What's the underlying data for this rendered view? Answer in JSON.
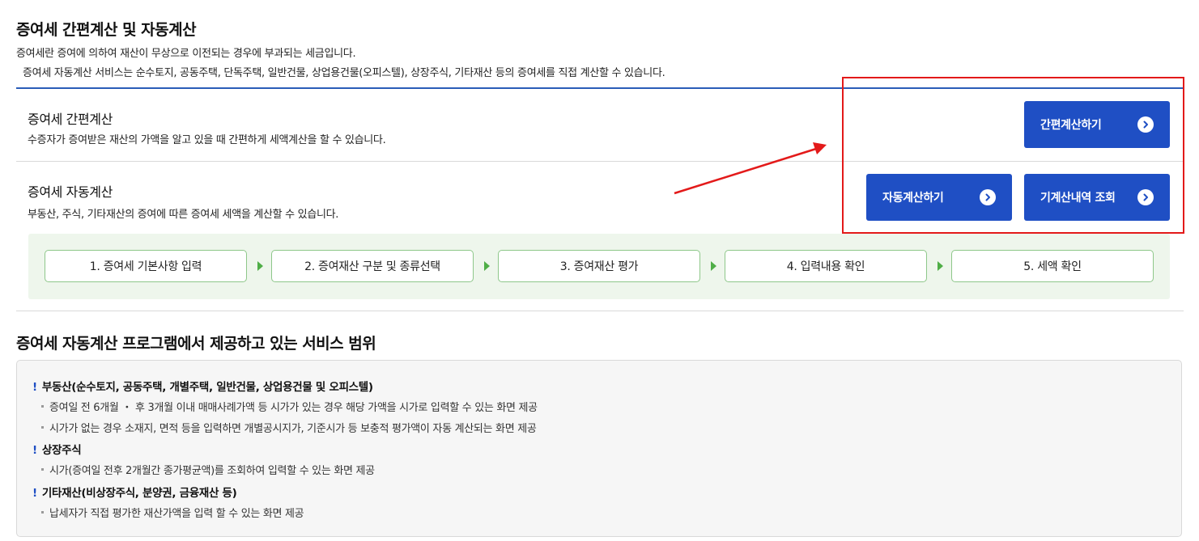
{
  "header": {
    "title": "증여세 간편계산 및 자동계산",
    "intro_line1": "증여세란 증여에 의하여 재산이 무상으로 이전되는 경우에 부과되는 세금입니다.",
    "intro_line2": "증여세 자동계산 서비스는 순수토지, 공동주택, 단독주택, 일반건물, 상업용건물(오피스텔), 상장주식, 기타재산 등의 증여세를 직접 계산할 수 있습니다."
  },
  "simple_calc": {
    "title": "증여세 간편계산",
    "desc": "수증자가 증여받은 재산의 가액을 알고 있을 때 간편하게 세액계산을 할 수 있습니다.",
    "button_label": "간편계산하기"
  },
  "auto_calc": {
    "title": "증여세 자동계산",
    "desc": "부동산, 주식, 기타재산의 증여에 따른 증여세 세액을 계산할 수 있습니다.",
    "button_auto_label": "자동계산하기",
    "button_history_label": "기계산내역 조회",
    "steps": [
      "1. 증여세 기본사항 입력",
      "2. 증여재산 구분 및 종류선택",
      "3. 증여재산 평가",
      "4. 입력내용 확인",
      "5. 세액 확인"
    ]
  },
  "scope": {
    "title": "증여세 자동계산 프로그램에서 제공하고 있는 서비스 범위",
    "groups": [
      {
        "heading": "부동산(순수토지, 공동주택, 개별주택, 일반건물, 상업용건물 및 오피스텔)",
        "items": [
          "증여일 전 6개월  ・ 후 3개월 이내 매매사례가액 등 시가가 있는 경우 해당 가액을 시가로 입력할 수 있는 화면 제공",
          "시가가 없는 경우 소재지, 면적 등을 입력하면 개별공시지가, 기준시가 등 보충적 평가액이 자동 계산되는 화면 제공"
        ]
      },
      {
        "heading": "상장주식",
        "items": [
          "시가(증여일 전후 2개월간 종가평균액)를 조회하여 입력할 수 있는 화면 제공"
        ]
      },
      {
        "heading": "기타재산(비상장주식, 분양권, 금융재산 등)",
        "items": [
          "납세자가 직접 평가한 재산가액을 입력 할 수 있는 화면 제공"
        ]
      }
    ],
    "bang": "!"
  },
  "colors": {
    "button_blue": "#1f4fc4",
    "rule_blue": "#2a5db8",
    "step_green": "#4fae47",
    "annotation_red": "#e31a1a"
  },
  "icons": {
    "button_circle": "chevron-right-circle-icon",
    "step_separator": "triangle-right-icon"
  }
}
